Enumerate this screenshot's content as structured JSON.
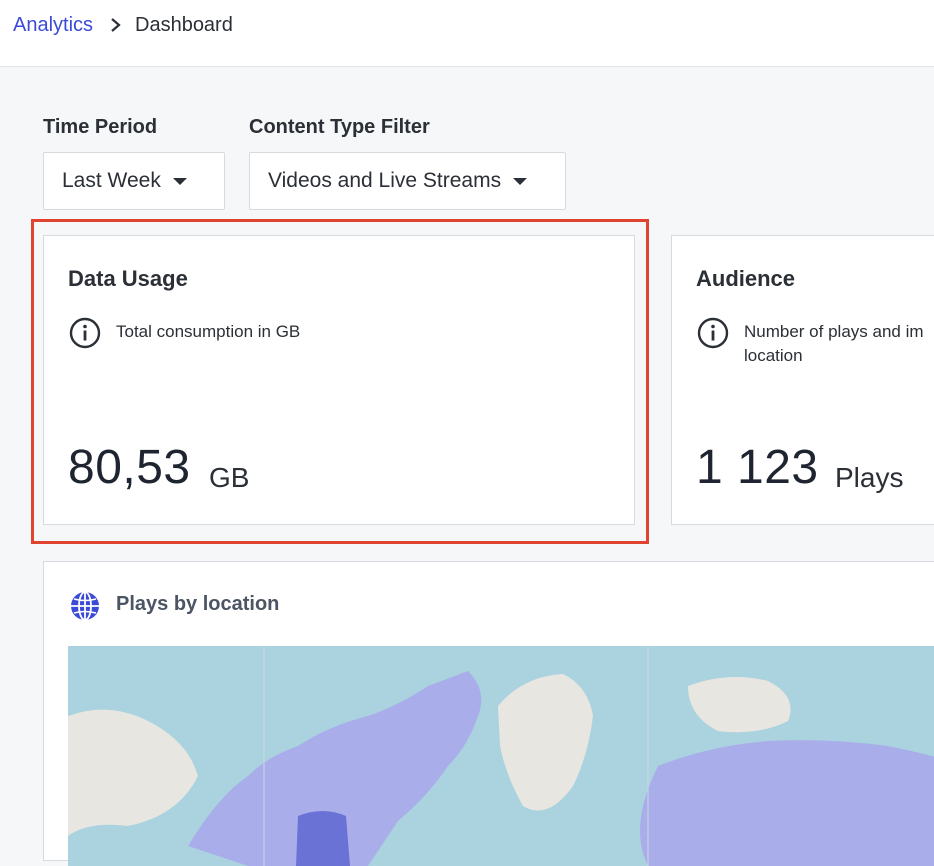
{
  "breadcrumb": {
    "root": "Analytics",
    "current": "Dashboard"
  },
  "filters": {
    "time_period": {
      "label": "Time Period",
      "value": "Last Week"
    },
    "content_type": {
      "label": "Content Type Filter",
      "value": "Videos and Live Streams"
    }
  },
  "cards": {
    "data_usage": {
      "title": "Data Usage",
      "description": "Total consumption in GB",
      "value": "80,53",
      "unit": "GB"
    },
    "audience": {
      "title": "Audience",
      "description": "Number of plays and im location",
      "value": "1 123",
      "unit": "Plays"
    }
  },
  "map": {
    "title": "Plays by location"
  },
  "colors": {
    "accent": "#3b4bd8",
    "highlight": "#e0432f",
    "water": "#aad3df",
    "land": "#e8e6e1",
    "plays_light": "#a9aeea",
    "plays_dark": "#6b72d6"
  }
}
